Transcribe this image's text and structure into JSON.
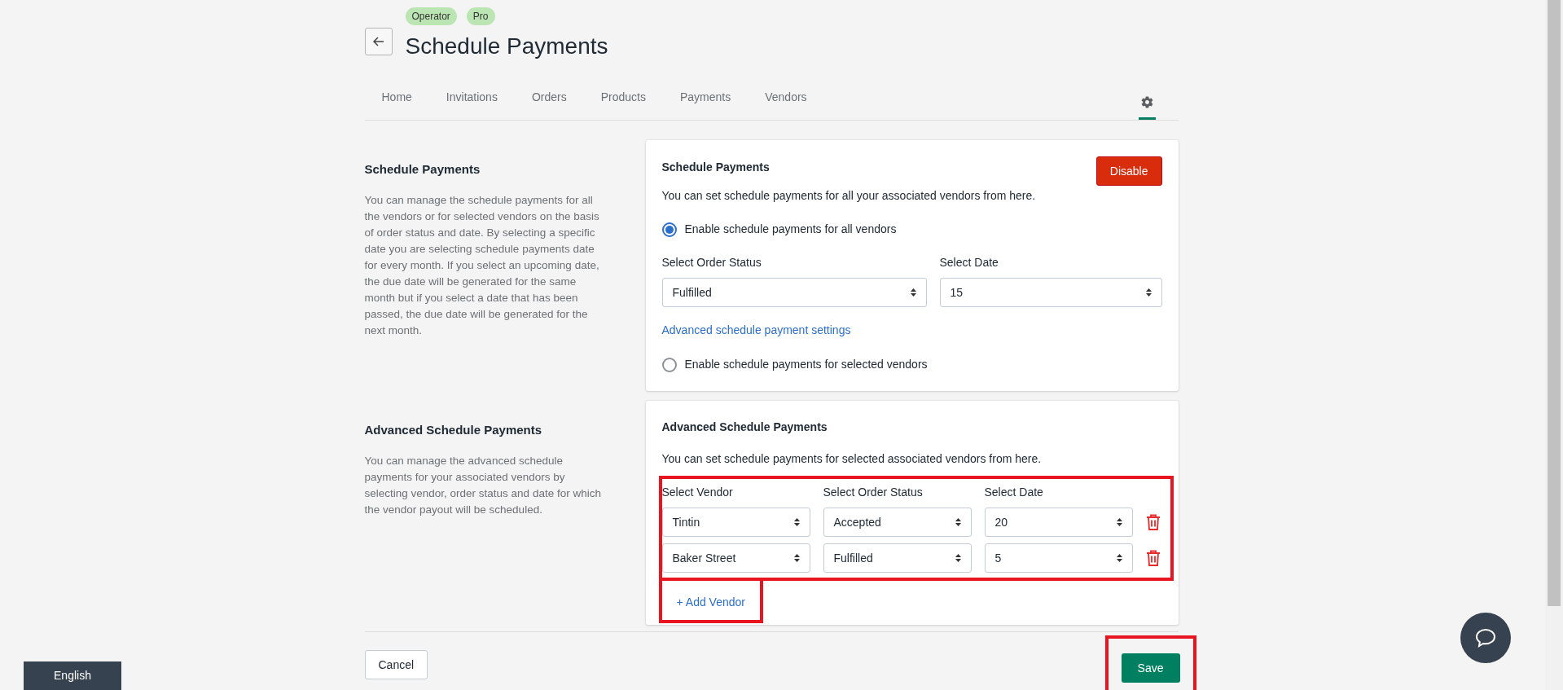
{
  "header": {
    "badges": [
      "Operator",
      "Pro"
    ],
    "title": "Schedule Payments"
  },
  "tabs": [
    {
      "label": "Home",
      "selected": false
    },
    {
      "label": "Invitations",
      "selected": false
    },
    {
      "label": "Orders",
      "selected": false
    },
    {
      "label": "Products",
      "selected": false
    },
    {
      "label": "Payments",
      "selected": false
    },
    {
      "label": "Vendors",
      "selected": false
    }
  ],
  "settings_tab": {
    "selected": true
  },
  "schedule_section": {
    "heading": "Schedule Payments",
    "description": "You can manage the schedule payments for all the vendors or for selected vendors on the basis of order status and date. By selecting a specific date you are selecting schedule payments date for every month. If you select an upcoming date, the due date will be generated for the same month but if you select a date that has been passed, the due date will be generated for the next month.",
    "card": {
      "title": "Schedule Payments",
      "disable_button": "Disable",
      "subtitle": "You can set schedule payments for all your associated vendors from here.",
      "all_vendors_option": {
        "label": "Enable schedule payments for all vendors",
        "selected": true
      },
      "order_status": {
        "label": "Select Order Status",
        "value": "Fulfilled"
      },
      "date": {
        "label": "Select Date",
        "value": "15"
      },
      "advanced_link": "Advanced schedule payment settings",
      "selected_vendors_option": {
        "label": "Enable schedule payments for selected vendors",
        "selected": false
      }
    }
  },
  "advanced_section": {
    "heading": "Advanced Schedule Payments",
    "description": "You can manage the advanced schedule payments for your associated vendors by selecting vendor, order status and date for which the vendor payout will be scheduled.",
    "card": {
      "title": "Advanced Schedule Payments",
      "subtitle": "You can set schedule payments for selected associated vendors from here.",
      "columns": [
        "Select Vendor",
        "Select Order Status",
        "Select Date"
      ],
      "rows_highlighted": true,
      "rows": [
        {
          "vendor": "Tintin",
          "order_status": "Accepted",
          "date": "20"
        },
        {
          "vendor": "Baker Street",
          "order_status": "Fulfilled",
          "date": "5"
        }
      ],
      "add_vendor": {
        "label": "+ Add Vendor",
        "highlighted": true
      }
    }
  },
  "footer": {
    "cancel": "Cancel",
    "save": {
      "label": "Save",
      "highlighted": true
    }
  },
  "language_tab": "English"
}
